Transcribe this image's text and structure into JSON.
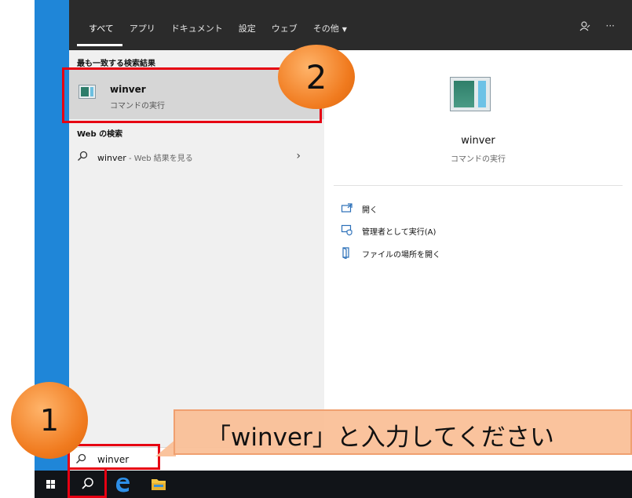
{
  "tabs": [
    {
      "label": "すべて",
      "active": true
    },
    {
      "label": "アプリ",
      "active": false
    },
    {
      "label": "ドキュメント",
      "active": false
    },
    {
      "label": "設定",
      "active": false
    },
    {
      "label": "ウェブ",
      "active": false
    },
    {
      "label": "その他",
      "active": false
    }
  ],
  "topbar": {
    "more_label": "···"
  },
  "best_match": {
    "section": "最も一致する検索結果",
    "title": "winver",
    "subtitle": "コマンドの実行"
  },
  "web_search": {
    "section": "Web の検索",
    "query": "winver",
    "suffix": " - Web 結果を見る",
    "chevron": "›"
  },
  "preview": {
    "title": "winver",
    "subtitle": "コマンドの実行"
  },
  "actions": [
    {
      "label": "開く",
      "icon": "open-icon"
    },
    {
      "label": "管理者として実行(A)",
      "icon": "shield-admin-icon"
    },
    {
      "label": "ファイルの場所を開く",
      "icon": "file-location-icon"
    }
  ],
  "searchbox": {
    "value": "winver"
  },
  "annotations": {
    "badge1": "1",
    "badge2": "2",
    "callout": "「winver」と入力してください"
  },
  "colors": {
    "accent_red": "#e60012",
    "badge_orange": "#f07a1e",
    "desktop_blue": "#1f86d8",
    "topbar": "#2b2b2b"
  }
}
